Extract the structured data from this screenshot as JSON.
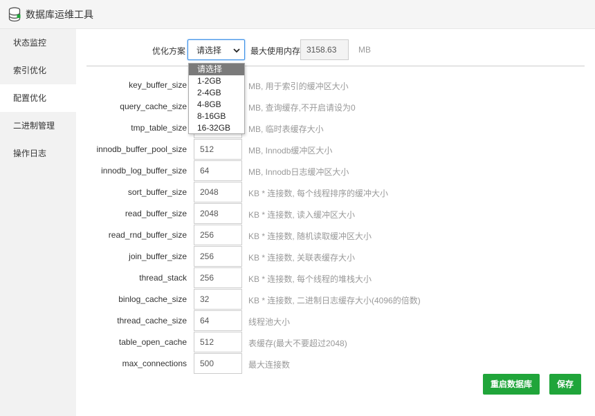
{
  "app": {
    "title": "数据库运维工具"
  },
  "sidebar": {
    "items": [
      {
        "label": "状态监控"
      },
      {
        "label": "索引优化"
      },
      {
        "label": "配置优化",
        "active": true
      },
      {
        "label": "二进制管理"
      },
      {
        "label": "操作日志"
      }
    ]
  },
  "toolbar": {
    "plan_label": "优化方案",
    "plan_selected": "请选择",
    "plan_options": [
      "请选择",
      "1-2GB",
      "2-4GB",
      "4-8GB",
      "8-16GB",
      "16-32GB"
    ],
    "max_mem_label": "最大使用内存",
    "max_mem_value": "3158.63",
    "max_mem_unit": "MB"
  },
  "config": [
    {
      "key": "key_buffer_size",
      "value": "",
      "desc": "MB, 用于索引的缓冲区大小"
    },
    {
      "key": "query_cache_size",
      "value": "",
      "desc": "MB, 查询缓存,不开启请设为0"
    },
    {
      "key": "tmp_table_size",
      "value": "",
      "desc": "MB, 临时表缓存大小"
    },
    {
      "key": "innodb_buffer_pool_size",
      "value": "512",
      "desc": "MB, Innodb缓冲区大小"
    },
    {
      "key": "innodb_log_buffer_size",
      "value": "64",
      "desc": "MB, Innodb日志缓冲区大小"
    },
    {
      "key": "sort_buffer_size",
      "value": "2048",
      "desc": "KB * 连接数, 每个线程排序的缓冲大小"
    },
    {
      "key": "read_buffer_size",
      "value": "2048",
      "desc": "KB * 连接数, 读入缓冲区大小"
    },
    {
      "key": "read_rnd_buffer_size",
      "value": "256",
      "desc": "KB * 连接数, 随机读取缓冲区大小"
    },
    {
      "key": "join_buffer_size",
      "value": "256",
      "desc": "KB * 连接数, 关联表缓存大小"
    },
    {
      "key": "thread_stack",
      "value": "256",
      "desc": "KB * 连接数, 每个线程的堆栈大小"
    },
    {
      "key": "binlog_cache_size",
      "value": "32",
      "desc": "KB * 连接数, 二进制日志缓存大小(4096的倍数)"
    },
    {
      "key": "thread_cache_size",
      "value": "64",
      "desc": "线程池大小"
    },
    {
      "key": "table_open_cache",
      "value": "512",
      "desc": "表缓存(最大不要超过2048)"
    },
    {
      "key": "max_connections",
      "value": "500",
      "desc": "最大连接数"
    }
  ],
  "actions": {
    "restart_label": "重启数据库",
    "save_label": "保存"
  },
  "colors": {
    "accent": "#20a53a",
    "focus": "#3a8ee6"
  }
}
